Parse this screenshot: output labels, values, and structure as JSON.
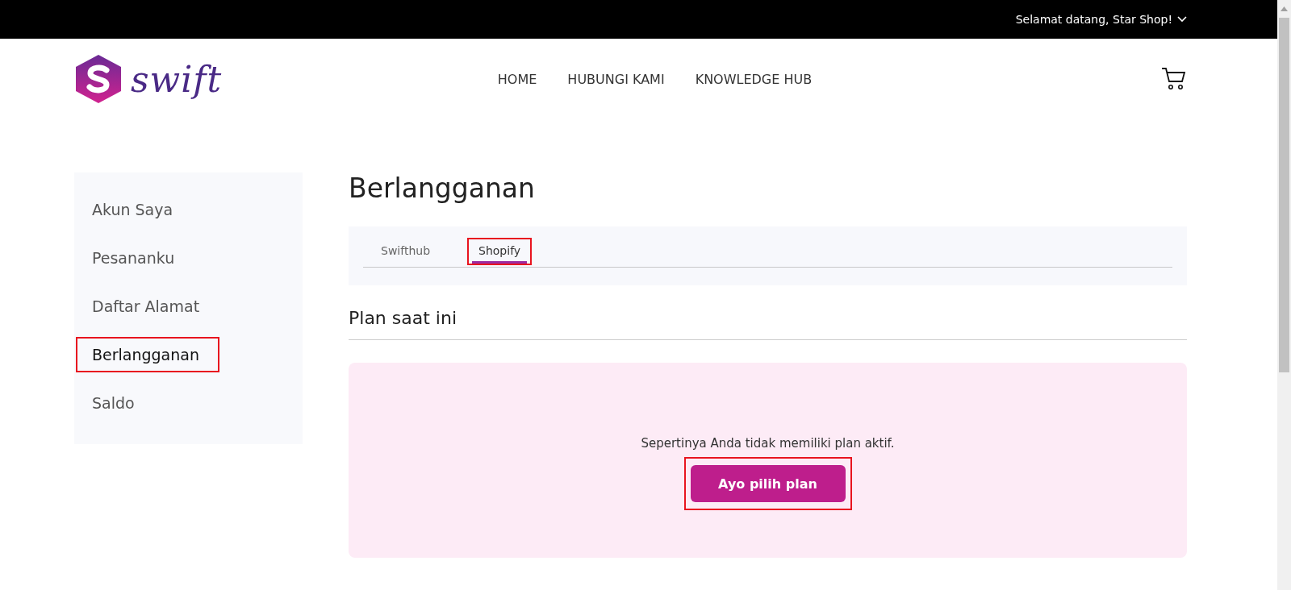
{
  "top_bar": {
    "greeting": "Selamat datang, Star Shop!"
  },
  "header": {
    "logo_text": "swift",
    "nav": [
      "HOME",
      "HUBUNGI KAMI",
      "KNOWLEDGE HUB"
    ]
  },
  "sidebar": {
    "items": [
      {
        "label": "Akun Saya",
        "selected": false,
        "highlighted": false
      },
      {
        "label": "Pesananku",
        "selected": false,
        "highlighted": false
      },
      {
        "label": "Daftar Alamat",
        "selected": false,
        "highlighted": false
      },
      {
        "label": "Berlangganan",
        "selected": true,
        "highlighted": true
      },
      {
        "label": "Saldo",
        "selected": false,
        "highlighted": false
      }
    ]
  },
  "main": {
    "title": "Berlangganan",
    "tabs": [
      {
        "label": "Swifthub",
        "selected": false,
        "highlighted": false
      },
      {
        "label": "Shopify",
        "selected": true,
        "highlighted": true
      }
    ],
    "section_title": "Plan saat ini",
    "empty_state": {
      "message": "Sepertinya Anda tidak memiliki plan aktif.",
      "button": "Ayo pilih plan",
      "highlighted": true
    }
  }
}
